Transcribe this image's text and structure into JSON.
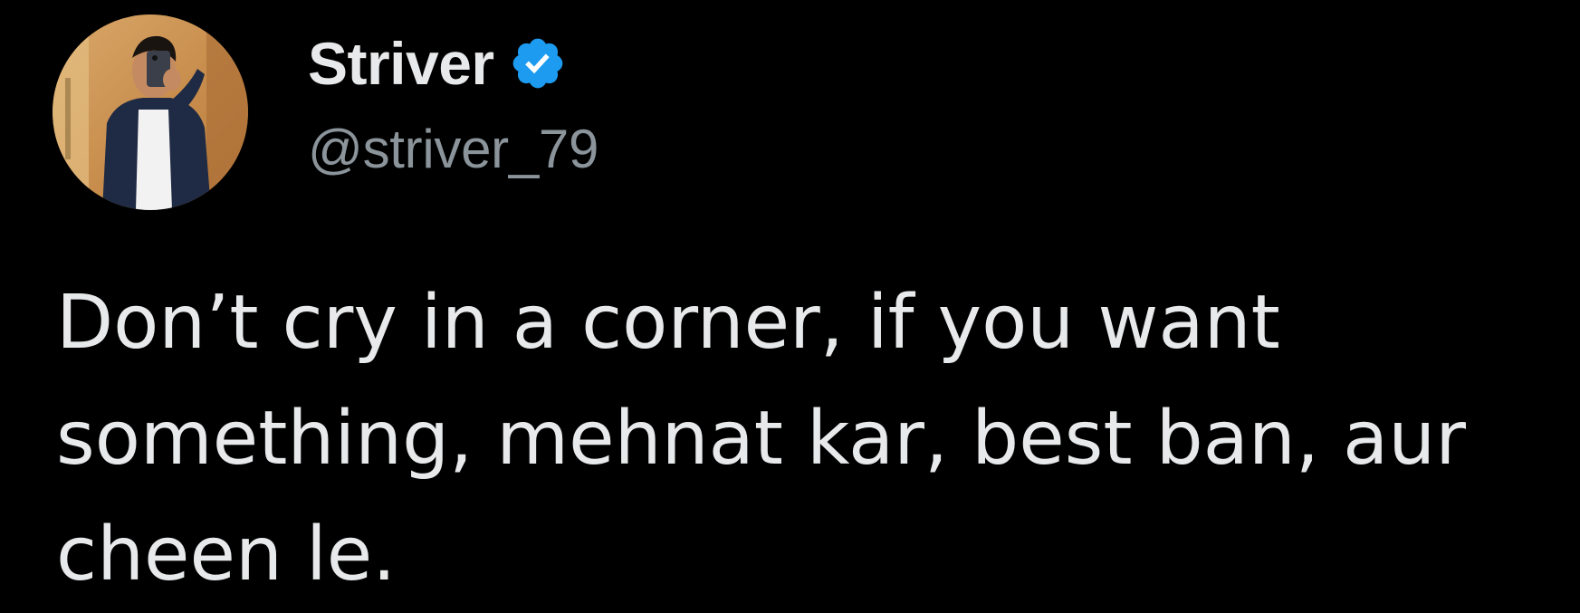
{
  "tweet": {
    "author": {
      "display_name": "Striver",
      "handle": "@striver_79",
      "verified": true,
      "avatar": "profile-photo"
    },
    "text_lines": [
      "Don’t cry in a corner, if you want",
      "something, mehnat kar, best ban, aur",
      "cheen le."
    ]
  },
  "colors": {
    "background": "#000000",
    "primary_text": "#e7e9ea",
    "secondary_text": "#8b949a",
    "verified_blue": "#1d9bf0"
  },
  "icons": {
    "verified": "verified-badge-icon"
  }
}
